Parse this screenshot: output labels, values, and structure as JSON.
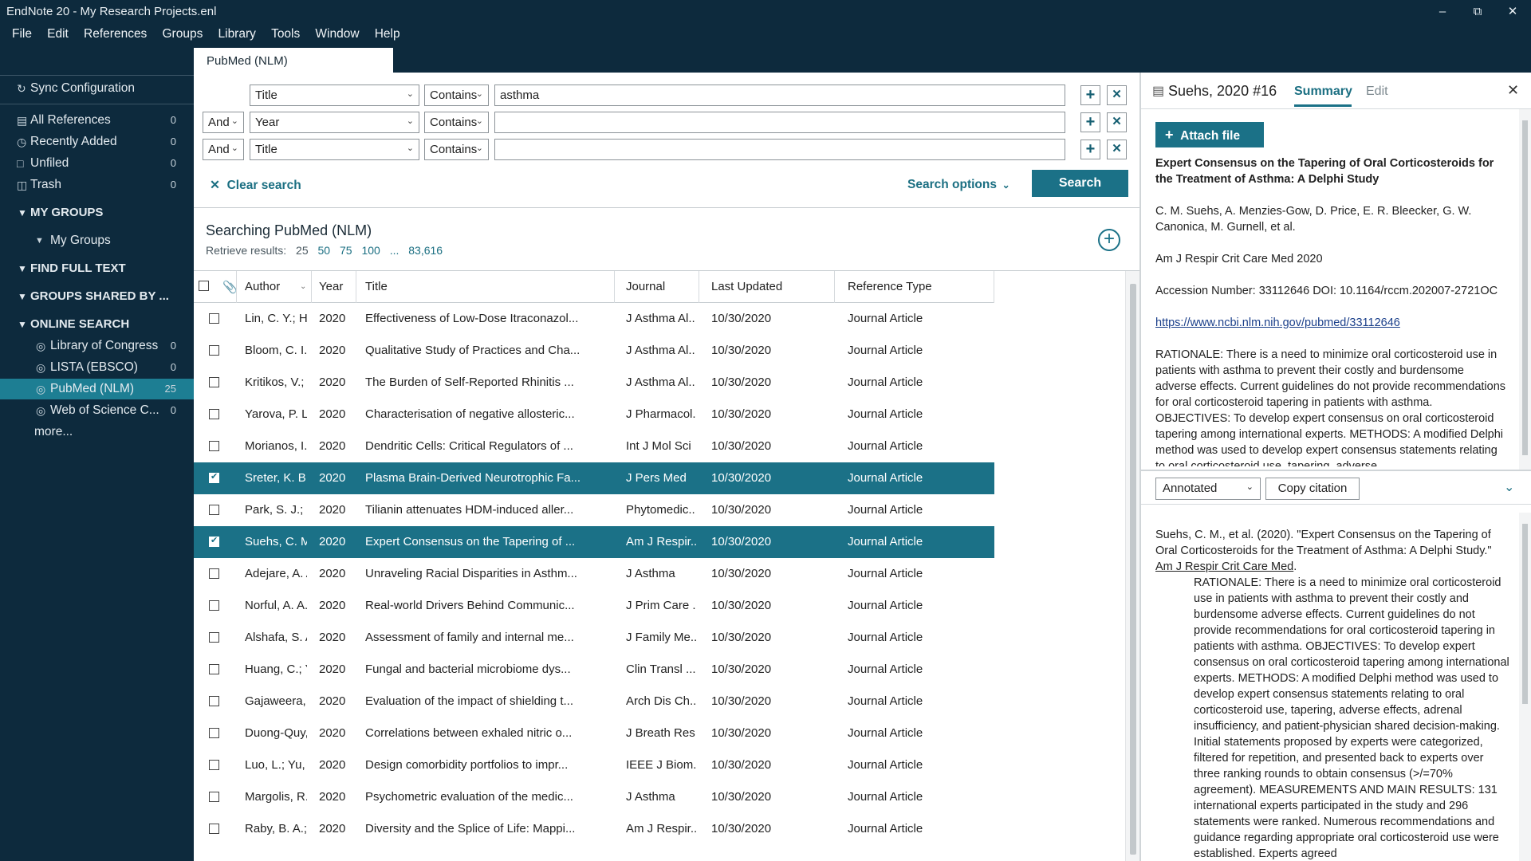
{
  "window": {
    "title": "EndNote 20 - My Research Projects.enl"
  },
  "menu": [
    "File",
    "Edit",
    "References",
    "Groups",
    "Library",
    "Tools",
    "Window",
    "Help"
  ],
  "sidebar": {
    "sync": "Sync Configuration",
    "library": [
      {
        "label": "All References",
        "count": "0"
      },
      {
        "label": "Recently Added",
        "count": "0"
      },
      {
        "label": "Unfiled",
        "count": "0"
      },
      {
        "label": "Trash",
        "count": "0"
      }
    ],
    "my_groups_header": "MY GROUPS",
    "my_groups_item": "My Groups",
    "find_full_text": "FIND FULL TEXT",
    "groups_shared": "GROUPS SHARED BY ...",
    "online_search": "ONLINE SEARCH",
    "online": [
      {
        "label": "Library of Congress",
        "count": "0"
      },
      {
        "label": "LISTA (EBSCO)",
        "count": "0"
      },
      {
        "label": "PubMed (NLM)",
        "count": "25"
      },
      {
        "label": "Web of Science C...",
        "count": "0"
      }
    ],
    "more": "more..."
  },
  "tab": {
    "label": "PubMed (NLM)"
  },
  "search": {
    "rows": [
      {
        "bool": "",
        "field": "Title",
        "op": "Contains",
        "value": "asthma"
      },
      {
        "bool": "And",
        "field": "Year",
        "op": "Contains",
        "value": ""
      },
      {
        "bool": "And",
        "field": "Title",
        "op": "Contains",
        "value": ""
      }
    ],
    "clear": "Clear search",
    "options": "Search options",
    "button": "Search"
  },
  "results": {
    "heading": "Searching PubMed (NLM)",
    "retrieve_label": "Retrieve results:",
    "retrieve_options": [
      "25",
      "50",
      "75",
      "100",
      "...",
      "83,616"
    ]
  },
  "table": {
    "columns": [
      "Author",
      "Year",
      "Title",
      "Journal",
      "Last Updated",
      "Reference Type"
    ],
    "rows": [
      {
        "author": "Lin, C. Y.; Hua...",
        "year": "2020",
        "title": "Effectiveness of Low-Dose Itraconazol...",
        "journal": "J Asthma Al...",
        "updated": "10/30/2020",
        "type": "Journal Article",
        "selected": false
      },
      {
        "author": "Bloom, C. I.; ...",
        "year": "2020",
        "title": "Qualitative Study of Practices and Cha...",
        "journal": "J Asthma Al...",
        "updated": "10/30/2020",
        "type": "Journal Article",
        "selected": false
      },
      {
        "author": "Kritikos, V.; P...",
        "year": "2020",
        "title": "The Burden of Self-Reported Rhinitis ...",
        "journal": "J Asthma Al...",
        "updated": "10/30/2020",
        "type": "Journal Article",
        "selected": false
      },
      {
        "author": "Yarova, P. L.; ...",
        "year": "2020",
        "title": "Characterisation of negative allosteric...",
        "journal": "J Pharmacol...",
        "updated": "10/30/2020",
        "type": "Journal Article",
        "selected": false
      },
      {
        "author": "Morianos, I.; ...",
        "year": "2020",
        "title": "Dendritic Cells: Critical Regulators of ...",
        "journal": "Int J Mol Sci",
        "updated": "10/30/2020",
        "type": "Journal Article",
        "selected": false
      },
      {
        "author": "Sreter, K. B.; ...",
        "year": "2020",
        "title": "Plasma Brain-Derived Neurotrophic Fa...",
        "journal": "J Pers Med",
        "updated": "10/30/2020",
        "type": "Journal Article",
        "selected": true
      },
      {
        "author": "Park, S. J.; Lee...",
        "year": "2020",
        "title": "Tilianin attenuates HDM-induced aller...",
        "journal": "Phytomedic...",
        "updated": "10/30/2020",
        "type": "Journal Article",
        "selected": false
      },
      {
        "author": "Suehs, C. M.; ...",
        "year": "2020",
        "title": "Expert Consensus on the Tapering of ...",
        "journal": "Am J Respir...",
        "updated": "10/30/2020",
        "type": "Journal Article",
        "selected": true
      },
      {
        "author": "Adejare, A. A...",
        "year": "2020",
        "title": "Unraveling Racial Disparities in Asthm...",
        "journal": "J Asthma",
        "updated": "10/30/2020",
        "type": "Journal Article",
        "selected": false
      },
      {
        "author": "Norful, A. A.; ...",
        "year": "2020",
        "title": "Real-world Drivers Behind Communic...",
        "journal": "J Prim Care ...",
        "updated": "10/30/2020",
        "type": "Journal Article",
        "selected": false
      },
      {
        "author": "Alshafa, S. A....",
        "year": "2020",
        "title": "Assessment of family and internal me...",
        "journal": "J Family Me...",
        "updated": "10/30/2020",
        "type": "Journal Article",
        "selected": false
      },
      {
        "author": "Huang, C.; Yu...",
        "year": "2020",
        "title": "Fungal and bacterial microbiome dys...",
        "journal": "Clin Transl ...",
        "updated": "10/30/2020",
        "type": "Journal Article",
        "selected": false
      },
      {
        "author": "Gajaweera, ...",
        "year": "2020",
        "title": "Evaluation of the impact of shielding t...",
        "journal": "Arch Dis Ch...",
        "updated": "10/30/2020",
        "type": "Journal Article",
        "selected": false
      },
      {
        "author": "Duong-Quy, ...",
        "year": "2020",
        "title": "Correlations between exhaled nitric o...",
        "journal": "J Breath Res",
        "updated": "10/30/2020",
        "type": "Journal Article",
        "selected": false
      },
      {
        "author": "Luo, L.; Yu, X.;...",
        "year": "2020",
        "title": "Design comorbidity portfolios to impr...",
        "journal": "IEEE J Biom...",
        "updated": "10/30/2020",
        "type": "Journal Article",
        "selected": false
      },
      {
        "author": "Margolis, R.; ...",
        "year": "2020",
        "title": "Psychometric evaluation of the medic...",
        "journal": "J Asthma",
        "updated": "10/30/2020",
        "type": "Journal Article",
        "selected": false
      },
      {
        "author": "Raby, B. A.; ...",
        "year": "2020",
        "title": "Diversity and the Splice of Life: Mappi...",
        "journal": "Am J Respir...",
        "updated": "10/30/2020",
        "type": "Journal Article",
        "selected": false
      }
    ]
  },
  "detail": {
    "ref_name": "Suehs, 2020 #16",
    "tab_summary": "Summary",
    "tab_edit": "Edit",
    "attach": "Attach file",
    "title": "Expert Consensus on the Tapering of Oral Corticosteroids for the Treatment of Asthma: A Delphi Study",
    "authors": "C. M. Suehs, A. Menzies-Gow, D. Price, E. R. Bleecker, G. W. Canonica, M. Gurnell, et al.",
    "journal": "Am J Respir Crit Care Med 2020",
    "accession": "Accession Number: 33112646 DOI: 10.1164/rccm.202007-2721OC",
    "url": "https://www.ncbi.nlm.nih.gov/pubmed/33112646",
    "abstract": "RATIONALE: There is a need to minimize oral corticosteroid use in patients with asthma to prevent their costly and burdensome adverse effects. Current guidelines do not provide recommendations for oral corticosteroid tapering in patients with asthma. OBJECTIVES: To develop expert consensus on oral corticosteroid tapering among international experts. METHODS: A modified Delphi method was used to develop expert consensus statements relating to oral corticosteroid use, tapering, adverse"
  },
  "citation": {
    "style": "Annotated",
    "copy": "Copy citation",
    "lead": "Suehs, C. M., et al. (2020). \"Expert Consensus on the Tapering of Oral Corticosteroids for the Treatment of Asthma: A Delphi Study.\" ",
    "journal": "Am J Respir Crit Care Med",
    "tail": ".",
    "abstract": "RATIONALE: There is a need to minimize oral corticosteroid use in patients with asthma to prevent their costly and burdensome adverse effects. Current guidelines do not provide recommendations for oral corticosteroid tapering in patients with asthma. OBJECTIVES: To develop expert consensus on oral corticosteroid tapering among international experts. METHODS: A modified Delphi method was used to develop expert consensus statements relating to oral corticosteroid use, tapering, adverse effects, adrenal insufficiency, and patient-physician shared decision-making. Initial statements proposed by experts were categorized, filtered for repetition, and presented back to experts over three ranking rounds to obtain consensus (>/=70% agreement). MEASUREMENTS AND MAIN RESULTS: 131 international experts participated in the study and 296 statements were ranked. Numerous recommendations and guidance regarding appropriate oral corticosteroid use were established. Experts agreed"
  }
}
